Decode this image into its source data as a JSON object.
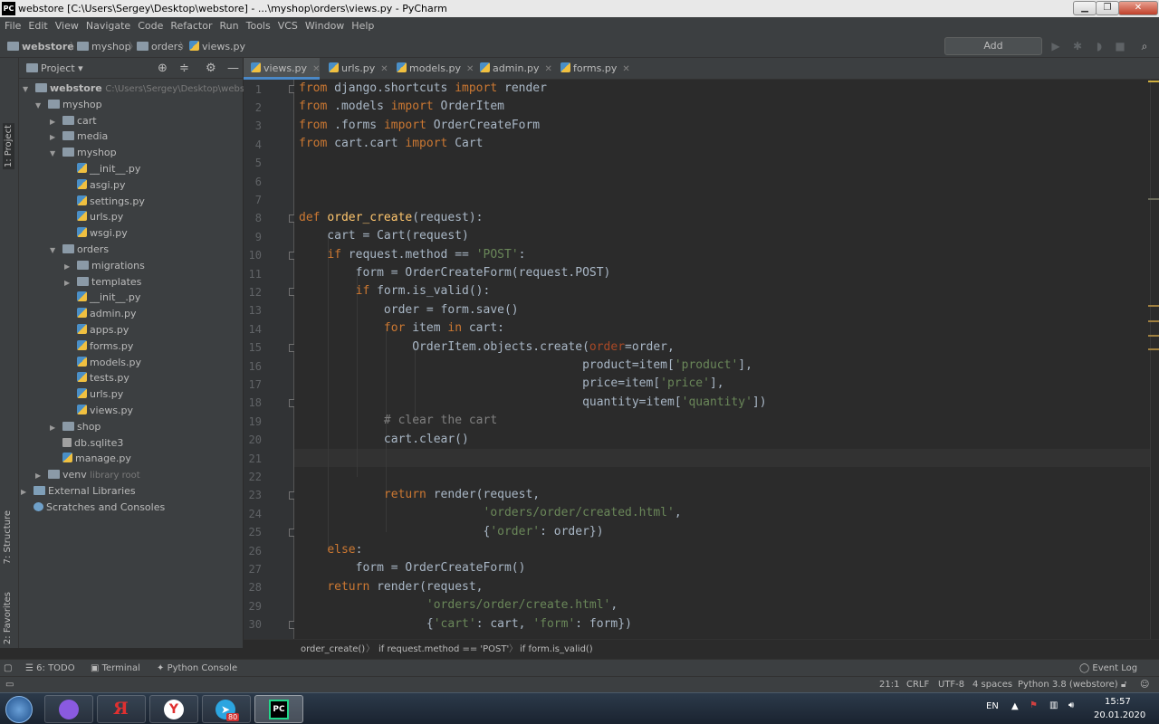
{
  "window": {
    "title": "webstore [C:\\Users\\Sergey\\Desktop\\webstore] - ...\\myshop\\orders\\views.py - PyCharm",
    "app_icon": "PC"
  },
  "menu": [
    "File",
    "Edit",
    "View",
    "Navigate",
    "Code",
    "Refactor",
    "Run",
    "Tools",
    "VCS",
    "Window",
    "Help"
  ],
  "breadcrumbs": [
    "webstore",
    "myshop",
    "orders",
    "views.py"
  ],
  "toolbar": {
    "add_config": "Add Configuration..."
  },
  "left_strip": {
    "project": "1: Project",
    "structure": "7: Structure",
    "favorites": "2: Favorites"
  },
  "project": {
    "header": "Project",
    "root": {
      "name": "webstore",
      "path": "C:\\Users\\Sergey\\Desktop\\webstore"
    },
    "items": [
      {
        "label": "myshop",
        "type": "folder",
        "depth": 1,
        "open": true
      },
      {
        "label": "cart",
        "type": "folder",
        "depth": 2,
        "open": false
      },
      {
        "label": "media",
        "type": "folder",
        "depth": 2,
        "open": false
      },
      {
        "label": "myshop",
        "type": "folder",
        "depth": 2,
        "open": true
      },
      {
        "label": "__init__.py",
        "type": "py",
        "depth": 3
      },
      {
        "label": "asgi.py",
        "type": "py",
        "depth": 3
      },
      {
        "label": "settings.py",
        "type": "py",
        "depth": 3
      },
      {
        "label": "urls.py",
        "type": "py",
        "depth": 3
      },
      {
        "label": "wsgi.py",
        "type": "py",
        "depth": 3
      },
      {
        "label": "orders",
        "type": "folder",
        "depth": 2,
        "open": true
      },
      {
        "label": "migrations",
        "type": "folder",
        "depth": 3,
        "open": false
      },
      {
        "label": "templates",
        "type": "folder",
        "depth": 3,
        "open": false
      },
      {
        "label": "__init__.py",
        "type": "py",
        "depth": 3
      },
      {
        "label": "admin.py",
        "type": "py",
        "depth": 3
      },
      {
        "label": "apps.py",
        "type": "py",
        "depth": 3
      },
      {
        "label": "forms.py",
        "type": "py",
        "depth": 3
      },
      {
        "label": "models.py",
        "type": "py",
        "depth": 3
      },
      {
        "label": "tests.py",
        "type": "py",
        "depth": 3
      },
      {
        "label": "urls.py",
        "type": "py",
        "depth": 3
      },
      {
        "label": "views.py",
        "type": "py",
        "depth": 3
      },
      {
        "label": "shop",
        "type": "folder",
        "depth": 2,
        "open": false
      },
      {
        "label": "db.sqlite3",
        "type": "db",
        "depth": 2
      },
      {
        "label": "manage.py",
        "type": "py",
        "depth": 2
      }
    ],
    "venv": {
      "label": "venv",
      "note": "library root"
    },
    "external": "External Libraries",
    "scratches": "Scratches and Consoles"
  },
  "tabs": [
    {
      "label": "views.py",
      "active": true
    },
    {
      "label": "urls.py",
      "active": false
    },
    {
      "label": "models.py",
      "active": false
    },
    {
      "label": "admin.py",
      "active": false
    },
    {
      "label": "forms.py",
      "active": false
    }
  ],
  "code_lines": [
    "from django.shortcuts import render",
    "from .models import OrderItem",
    "from .forms import OrderCreateForm",
    "from cart.cart import Cart",
    "",
    "",
    "",
    "def order_create(request):",
    "    cart = Cart(request)",
    "    if request.method == 'POST':",
    "        form = OrderCreateForm(request.POST)",
    "        if form.is_valid():",
    "            order = form.save()",
    "            for item in cart:",
    "                OrderItem.objects.create(order=order,",
    "                                        product=item['product'],",
    "                                        price=item['price'],",
    "                                        quantity=item['quantity'])",
    "            # clear the cart",
    "            cart.clear()",
    "",
    "",
    "            return render(request,",
    "                          'orders/order/created.html',",
    "                          {'order': order})",
    "    else:",
    "        form = OrderCreateForm()",
    "    return render(request,",
    "                  'orders/order/create.html',",
    "                  {'cart': cart, 'form': form})"
  ],
  "code_breadcrumb": [
    "order_create()",
    "if request.method == 'POST'",
    "if form.is_valid()"
  ],
  "bottom_tabs": {
    "todo": "6: TODO",
    "terminal": "Terminal",
    "console": "Python Console",
    "event_log": "Event Log"
  },
  "status": {
    "position": "21:1",
    "line_sep": "CRLF",
    "encoding": "UTF-8",
    "indent": "4 spaces",
    "interpreter": "Python 3.8 (webstore)"
  },
  "taskbar": {
    "lang": "EN",
    "time": "15:57",
    "date": "20.01.2020",
    "telegram_badge": "80"
  }
}
